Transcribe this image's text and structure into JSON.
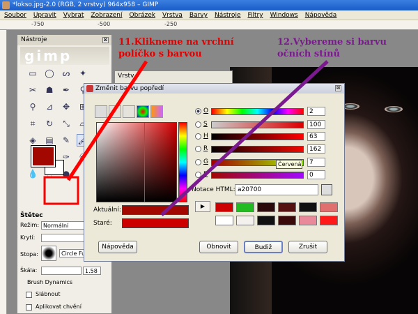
{
  "window": {
    "title": "*lokso.jpg-2.0 (RGB, 2 vrstvy) 964x958 – GIMP"
  },
  "menu": [
    "Soubor",
    "Upravit",
    "Vybrat",
    "Zobrazení",
    "Obrázek",
    "Vrstva",
    "Barvy",
    "Nástroje",
    "Filtry",
    "Windows",
    "Nápověda"
  ],
  "ruler": {
    "ticks": [
      "-750",
      "-500",
      "-250"
    ]
  },
  "toolbox": {
    "title": "Nástroje",
    "close": "⊠",
    "logo": "gimp",
    "options": {
      "title": "Štětec",
      "mode_label": "Režim:",
      "mode_value": "Normální",
      "opacity_label": "Krytí:",
      "brush_label": "Stopa:",
      "brush_value": "Circle Fuzz",
      "scale_label": "Škála:",
      "scale_value": "1.58",
      "dynamics_label": "Brush Dynamics",
      "fade_label": "Slábnout",
      "jitter_label": "Aplikovat chvění"
    }
  },
  "fg_color": "#a20700",
  "layers_panel": {
    "title": "Vrstv"
  },
  "dialog": {
    "title": "Změnit barvu popředí",
    "close": "⊠",
    "channels": [
      {
        "label": "O",
        "value": "2",
        "selected": true
      },
      {
        "label": "S",
        "value": "100",
        "selected": false
      },
      {
        "label": "H",
        "value": "63",
        "selected": false
      },
      {
        "label": "R",
        "value": "162",
        "selected": false
      },
      {
        "label": "G",
        "value": "7",
        "selected": false
      },
      {
        "label": "B",
        "value": "0",
        "selected": false
      }
    ],
    "tooltip": "Červená",
    "hex_label": "Notace HTML:",
    "hex_value": "a20700",
    "history": [
      "#cc0000",
      "#22bb22",
      "#2a0a0a",
      "#551010",
      "#111111",
      "#e07070",
      "#ffffff",
      "#f4f0ee",
      "#111111",
      "#3a0a0a",
      "#e88a9a",
      "#ff1a1a"
    ],
    "current_label": "Aktuální:",
    "old_label": "Staré:",
    "buttons": {
      "help": "Nápověda",
      "reset": "Obnovit",
      "ok": "Budiž",
      "cancel": "Zrušit"
    }
  },
  "annotations": {
    "step11": "11.Klikneme na vrchní políčko s barvou",
    "step12": "12.Vybereme si barvu očních stínů",
    "step11_color": "#e00000",
    "step12_color": "#7a1a8e"
  }
}
